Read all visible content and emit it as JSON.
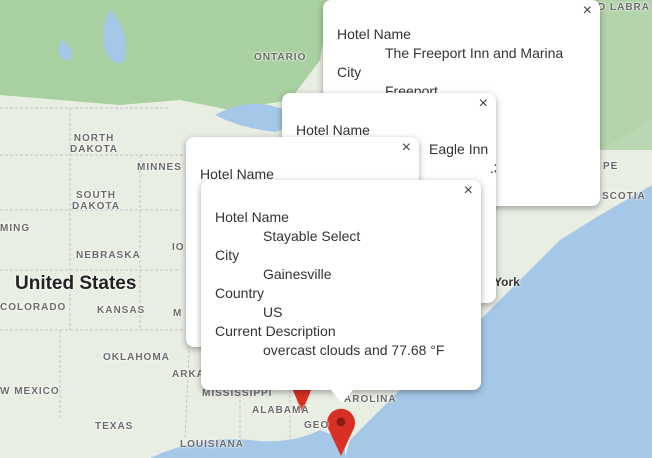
{
  "map": {
    "labels": {
      "ontario": "ONTARIO",
      "north_dakota": "NORTH\nDAKOTA",
      "south_dakota": "SOUTH\nDAKOTA",
      "nebraska": "NEBRASKA",
      "kansas": "KANSAS",
      "oklahoma": "OKLAHOMA",
      "texas": "TEXAS",
      "new_mexico": "W MEXICO",
      "colorado": "COLORADO",
      "minnesota": "MINNES",
      "iowa": "IO",
      "missouri": "M",
      "arkansas": "ARKA",
      "mississippi": "MISSISSIPPI",
      "alabama": "ALABAMA",
      "georgia": "GEO",
      "carolina": "AROLINA",
      "louisiana": "LOUISIANA",
      "wyoming": "MING",
      "united_states": "United States",
      "new_york": "York",
      "nova_scotia": "SCOTIA",
      "pe": "PE",
      "labrador": "D LABRA",
      "lake_huron_mark": ""
    }
  },
  "popups": [
    {
      "id": "freeport",
      "rows": [
        "Hotel Name",
        "The Freeport Inn and Marina",
        "City",
        "Freeport"
      ],
      "close": "×"
    },
    {
      "id": "eagle",
      "rows": [
        "Hotel Name",
        "Eagle Inn",
        ".37 °F"
      ],
      "close": "×"
    },
    {
      "id": "third",
      "rows": [
        "Hotel Name"
      ],
      "close": "×"
    },
    {
      "id": "gainesville",
      "rows": [
        "Hotel Name",
        "Stayable Select",
        "City",
        "Gainesville",
        "Country",
        "US",
        "Current Description",
        "overcast clouds and 77.68 °F"
      ],
      "close": "×"
    }
  ],
  "colors": {
    "water": "#a6c8e8",
    "land": "#e8efe1",
    "forest": "#b8d6b0",
    "pin": "#d93025"
  }
}
